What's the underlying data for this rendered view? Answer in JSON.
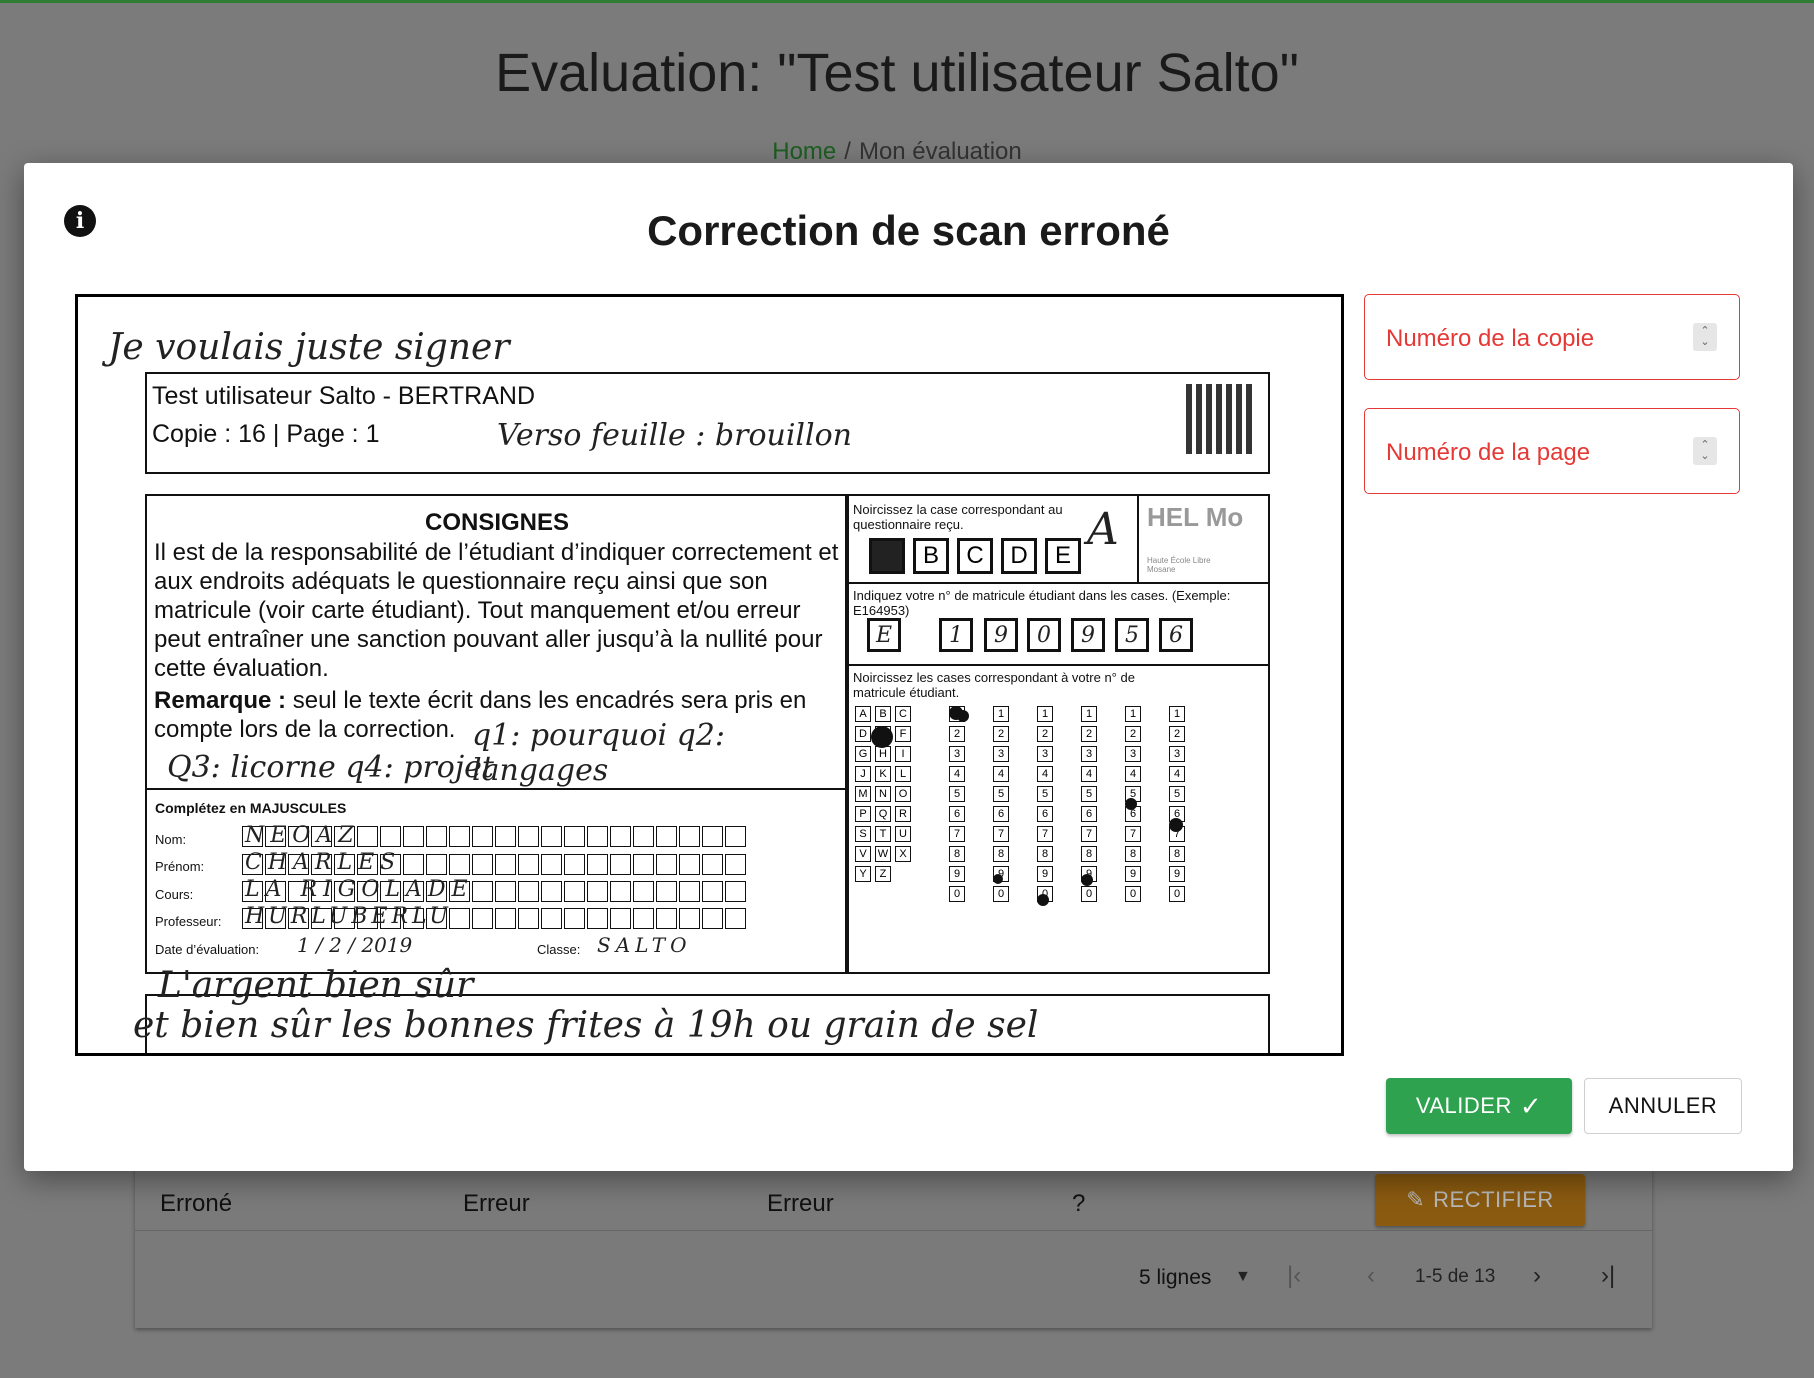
{
  "page": {
    "title": "Evaluation: \"Test utilisateur Salto\"",
    "breadcrumb": {
      "home": "Home",
      "separator": "/",
      "current": "Mon évaluation"
    }
  },
  "table": {
    "row": {
      "c1": "Erroné",
      "c2": "Erreur",
      "c3": "Erreur",
      "c4": "?",
      "action": "RECTIFIER"
    },
    "footer": {
      "rows_per_page": "5 lignes",
      "range": "1-5 de 13"
    }
  },
  "modal": {
    "title": "Correction de scan erroné",
    "fields": {
      "copy_label": "Numéro de la copie",
      "page_label": "Numéro de la page"
    },
    "buttons": {
      "validate": "VALIDER",
      "cancel": "ANNULER"
    }
  },
  "scan": {
    "handwriting_top": "Je voulais juste signer",
    "header_line1": "Test utilisateur Salto - BERTRAND",
    "header_line2": "Copie : 16 | Page : 1",
    "handwriting_header": "Verso feuille : brouillon",
    "consignes_title": "CONSIGNES",
    "consignes_text": "Il est de la responsabilité de l’étudiant d’indiquer correctement et aux endroits adéquats le questionnaire reçu ainsi que son matricule (voir carte étudiant). Tout manquement et/ou erreur peut entraîner une sanction pouvant aller jusqu’à la nullité pour cette évaluation.",
    "remarque_label": "Remarque :",
    "remarque_text": "seul le texte écrit dans les encadrés sera pris en compte lors de la correction.",
    "handwriting_q1": "q1: pourquoi  q2: langages",
    "handwriting_q3": "Q3: licorne   q4: projet",
    "complete_label": "Complétez en MAJUSCULES",
    "name_label": "Nom:",
    "name_value": "NEOAZ",
    "firstname_label": "Prénom:",
    "firstname_value": "CHARLES",
    "course_label": "Cours:",
    "course_value": "LA RIGOLADE",
    "prof_label": "Professeur:",
    "prof_value": "HURLUBERLU",
    "date_label": "Date d’évaluation:",
    "date_value": "1 / 2 / 2019",
    "class_label": "Classe:",
    "class_value": "SALTO",
    "questionnaire_label": "Noircissez la case correspondant au questionnaire reçu.",
    "questionnaire_boxes": [
      "A",
      "B",
      "C",
      "D",
      "E"
    ],
    "questionnaire_hand": "A",
    "logo_text": "HEL Mo",
    "logo_sub": "Haute École Libre Mosane",
    "matricule_label": "Indiquez votre n° de matricule étudiant dans les cases. (Exemple: E164953)",
    "matricule_digits": [
      "E",
      "1",
      "9",
      "0",
      "9",
      "5",
      "6"
    ],
    "grid_label": "Noircissez les cases correspondant à votre n° de matricule étudiant.",
    "letters": [
      "A",
      "B",
      "C",
      "D",
      "E",
      "F",
      "G",
      "H",
      "I",
      "J",
      "K",
      "L",
      "M",
      "N",
      "O",
      "P",
      "Q",
      "R",
      "S",
      "T",
      "U",
      "V",
      "W",
      "X",
      "Y",
      "Z"
    ],
    "numbers": [
      "1",
      "2",
      "3",
      "4",
      "5",
      "6",
      "7",
      "8",
      "9",
      "0"
    ],
    "handwriting_bottom1": "L'argent bien sûr",
    "handwriting_bottom2": "et bien sûr les bonnes frites à 19h ou grain de sel"
  }
}
